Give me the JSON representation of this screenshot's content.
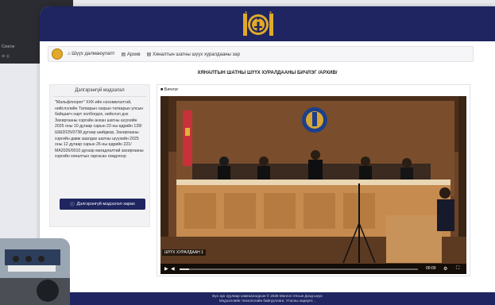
{
  "background": {
    "left_text": "Сонгон",
    "left_dots": "⊕ ◎"
  },
  "header": {
    "emblem_icon": "soyombo-emblem-icon"
  },
  "breadcrumb": {
    "home": "Шүүх далмаюулапт",
    "archive": "Архив",
    "current": "Хяналтын шатны шүүх хуралдааны зар"
  },
  "page": {
    "title": "ХЯНАЛТЫН ШАТНЫ ШҮҮХ ХУРАЛДААНЫ БИЧЛЭГ /АРХИВ/"
  },
  "details": {
    "title": "Дэлгэрэнгүй мэдээлэл",
    "text": "\"Мальфлоорет\" ХХК-ийн нэхэмжлэлтэй, нийслэлийн Татварын газрын татварын улсын байцаагч нарт холбогдох, нийслэл дэх Захиргааны хэргийн анхан шатны шүүхийн 2025 оны 10 дугаар сарын 22-ны өдрийн 128/ШШ2025/0738 дугаар шийдвэр, Захиргааны хэргийн давж заалдах шатны шүүхийн 2025 оны 12 дугаар сарын 26-ны өдрийн 221/МА2026/0010 дугаар магадлалтай захиргааны хэргийн хяналтын гаргасан гомдлоор",
    "button": "Дэлгэрэнгүй мэдээлэл харах"
  },
  "player": {
    "label": "Бичлэг",
    "video_title": "ШҮҮХ ХУРАЛДААН 1",
    "time": "00:00",
    "progress": 0.04
  },
  "footer": {
    "line1": "Бүх эрх хуулиар хамгаалагдсан © 2026 Монгол Улсын Дээд шүүх",
    "line2": "Мэдээллийн технологийн байгууллага. Утасны хариулт..."
  },
  "colors": {
    "brand": "#1e2560",
    "accent": "#e0a92a"
  }
}
